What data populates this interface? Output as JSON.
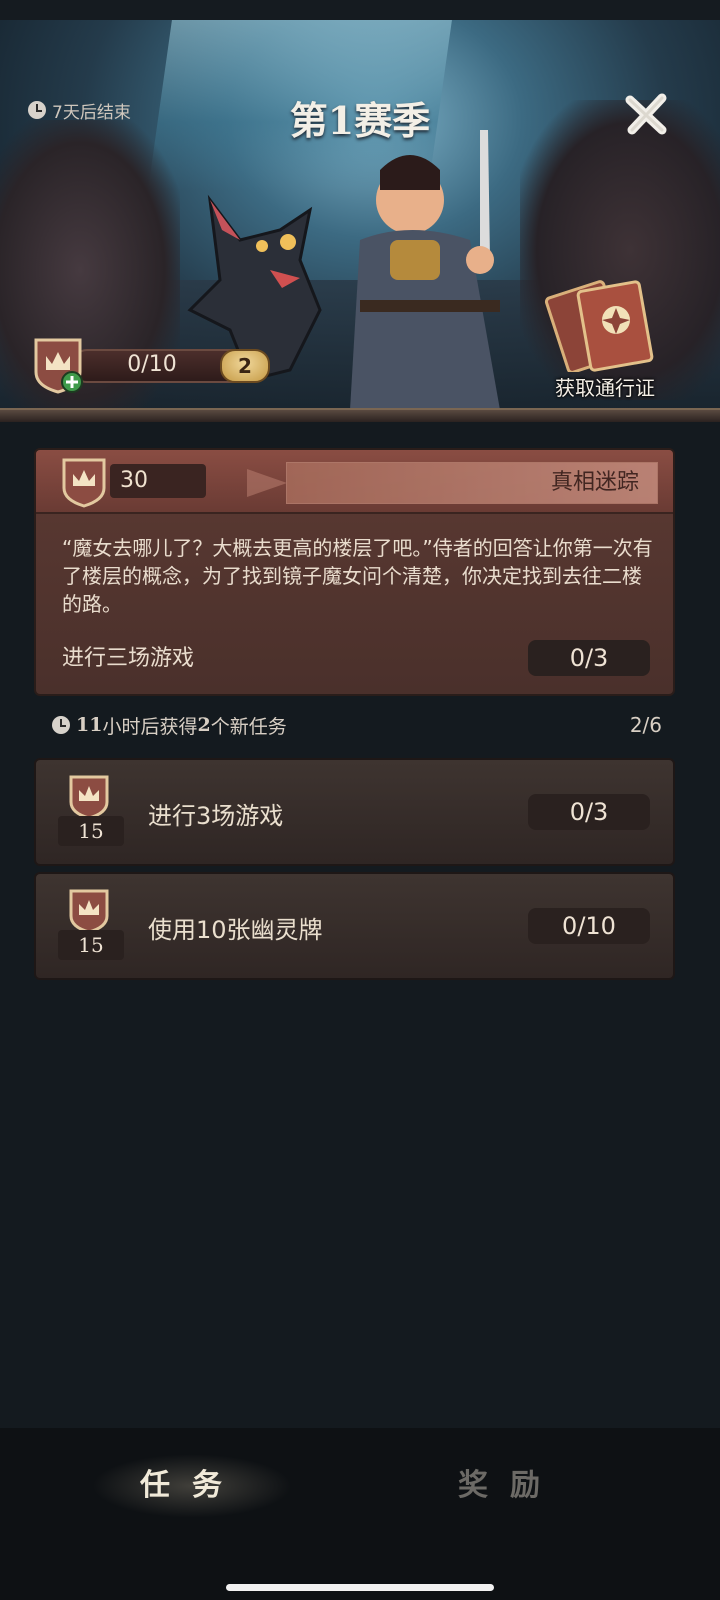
{
  "header": {
    "timer_text": "7天后结束",
    "season_title": "第1赛季",
    "level_progress": "0/10",
    "level_badge": "2",
    "pass_label": "获取通行证"
  },
  "featured_quest": {
    "points": "30",
    "title": "真相迷踪",
    "story": "“魔女去哪儿了？大概去更高的楼层了吧。”侍者的回答让你第一次有了楼层的概念，为了找到镜子魔女问个清楚，你决定找到去往二楼的路。",
    "task": "进行三场游戏",
    "progress": "0/3"
  },
  "refresh": {
    "hours": "11",
    "text_mid": "小时后获得",
    "count_new": "2",
    "text_end": "个新任务",
    "page_count": "2/6"
  },
  "quests": [
    {
      "points": "15",
      "label": "进行3场游戏",
      "progress": "0/3"
    },
    {
      "points": "15",
      "label": "使用10张幽灵牌",
      "progress": "0/10"
    }
  ],
  "tabs": {
    "tasks": "任务",
    "rewards": "奖励"
  },
  "colors": {
    "background": "#141a1f",
    "card_red": "#5c3a33",
    "card_dark": "#3e3430",
    "badge_gold": "#c59a45"
  }
}
